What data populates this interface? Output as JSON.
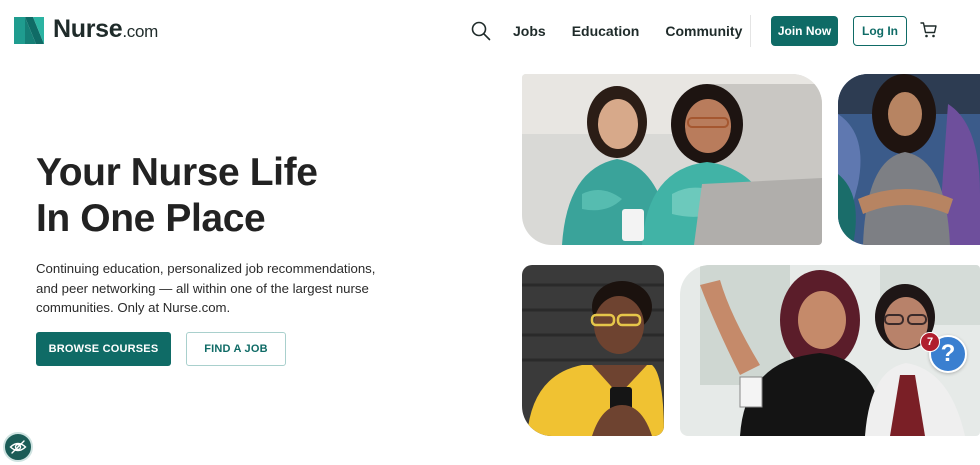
{
  "brand": {
    "name": "Nurse",
    "suffix": ".com",
    "primary_color": "#0f6b66",
    "logo_icon": "nurse-logo-mark"
  },
  "nav": {
    "search_icon": "search-icon",
    "links": [
      "Jobs",
      "Education",
      "Community"
    ],
    "join_label": "Join Now",
    "login_label": "Log In",
    "cart_icon": "cart-icon"
  },
  "hero": {
    "title_line1": "Your Nurse Life",
    "title_line2": "In One Place",
    "description": "Continuing education, personalized job recommendations, and peer networking — all within one of the largest nurse communities. Only at Nurse.com.",
    "browse_label": "BROWSE COURSES",
    "findjob_label": "FIND A JOB"
  },
  "help_widget": {
    "icon": "?",
    "badge_count": "7"
  },
  "accessibility": {
    "icon": "eye-slash-icon"
  }
}
